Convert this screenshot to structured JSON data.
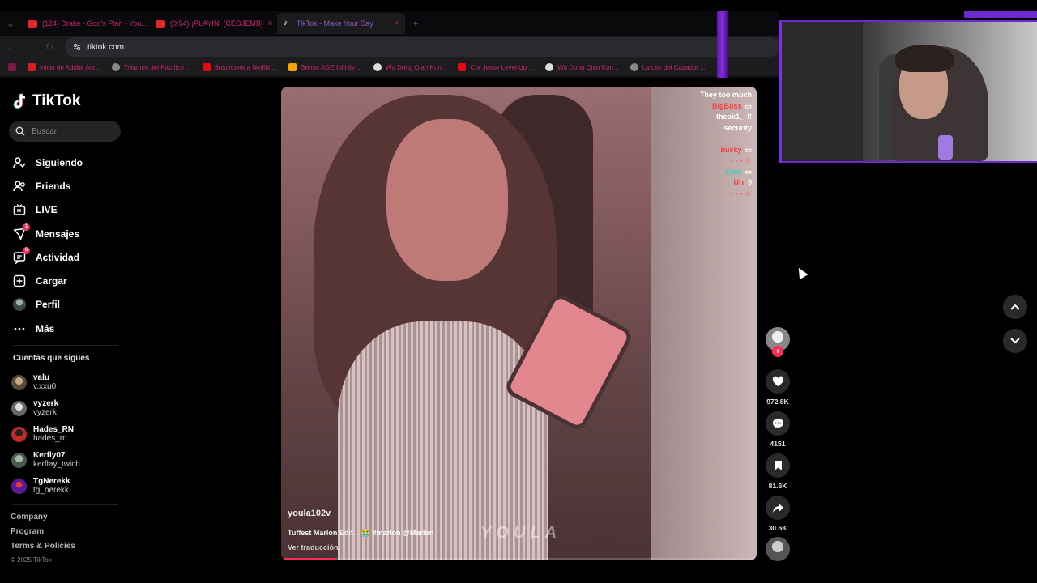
{
  "browser": {
    "tabs": [
      {
        "label": "(124) Drake - God's Plan - You...",
        "icon": "youtube-icon",
        "active": false
      },
      {
        "label": "(0:54) ¡PLAYIN! (CEOJEMB)",
        "icon": "youtube-icon",
        "active": false
      },
      {
        "label": "TikTok - Make Your Day",
        "icon": "tiktok-icon",
        "active": true
      }
    ],
    "url": "tiktok.com",
    "bookmarks": [
      {
        "label": "Inicio de Adobe Acr...",
        "color": "#d4201e"
      },
      {
        "label": "Trilantes del Pacífico ...",
        "color": "#888888"
      },
      {
        "label": "Suscribete a Netflix ...",
        "color": "#e50914"
      },
      {
        "label": "Sense AGE Infinity ...",
        "color": "#f4a400"
      },
      {
        "label": "Wu Dong Qian Kun...",
        "color": "#dddddd"
      },
      {
        "label": "Chr Jesse Level Up ...",
        "color": "#e50914"
      },
      {
        "label": "Wu Dong Qian Kun...",
        "color": "#dddddd"
      },
      {
        "label": "La Ley del Cazador ...",
        "color": "#888888"
      }
    ]
  },
  "sidebar": {
    "logo": "TikTok",
    "search_placeholder": "Buscar",
    "nav": [
      {
        "label": "Siguiendo",
        "icon": "following-icon",
        "badge": ""
      },
      {
        "label": "Friends",
        "icon": "friends-icon",
        "badge": ""
      },
      {
        "label": "LIVE",
        "icon": "live-icon",
        "badge": ""
      },
      {
        "label": "Mensajes",
        "icon": "messages-icon",
        "badge": "1"
      },
      {
        "label": "Actividad",
        "icon": "activity-icon",
        "badge": "6"
      },
      {
        "label": "Cargar",
        "icon": "upload-icon",
        "badge": ""
      },
      {
        "label": "Perfil",
        "icon": "profile-avatar",
        "badge": ""
      },
      {
        "label": "Más",
        "icon": "more-icon",
        "badge": ""
      }
    ],
    "following_title": "Cuentas que sigues",
    "following": [
      {
        "name": "valu",
        "user": "v.xxu0",
        "color": "#7a6a5a"
      },
      {
        "name": "vyzerk",
        "user": "vyzerk",
        "color": "#888888"
      },
      {
        "name": "Hades_RN",
        "user": "hades_rn",
        "color": "#c22a2a"
      },
      {
        "name": "Kerfly07",
        "user": "kerflay_twich",
        "color": "#6a7a6a"
      },
      {
        "name": "TgNerekk",
        "user": "tg_nerekk",
        "color": "#7a2ab0"
      }
    ],
    "footer": {
      "company": "Company",
      "program": "Program",
      "terms": "Terms & Policies",
      "copyright": "© 2025 TikTok"
    }
  },
  "video": {
    "username": "youla102v",
    "caption": "Tuffest Marlon Edit... 😭",
    "hashtag": "#marlon @Marlon",
    "translate": "Ver traducción",
    "watermark": "YOULA",
    "progress": 0.11,
    "chat": [
      {
        "user": "",
        "text": "They too much"
      },
      {
        "user": "BigBoss",
        "text": ""
      },
      {
        "user": "theok1_",
        "text": "!!"
      },
      {
        "user": "",
        "text": "security"
      },
      {
        "user": "",
        "text": ""
      },
      {
        "user": "bucky",
        "text": ""
      },
      {
        "user": "",
        "text": ""
      },
      {
        "user": "Lewi",
        "text": ""
      },
      {
        "user": "Urr",
        "text": "0"
      },
      {
        "user": "",
        "text": ""
      }
    ]
  },
  "actions": {
    "likes": "972.8K",
    "comments": "4151",
    "saves": "81.6K",
    "shares": "30.6K"
  },
  "colors": {
    "accent": "#fe2c55",
    "stream_border": "#6a2ad0",
    "tab_text": "#c9266b"
  }
}
